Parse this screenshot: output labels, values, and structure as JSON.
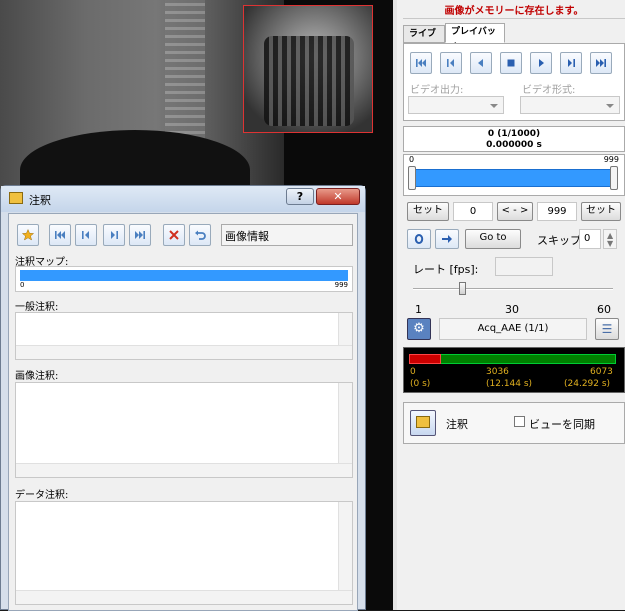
{
  "memory_status": "画像がメモリーに存在します。",
  "tabs": [
    {
      "label": "ライブ"
    },
    {
      "label": "プレイバック"
    }
  ],
  "playback": {
    "video_output_label": "ビデオ出力:",
    "video_format_label": "ビデオ形式:",
    "frame_display": "0 (1/1000)",
    "time_display": "0.000000 s",
    "slider_min": "0",
    "slider_max": "999",
    "set_left_label": "セット",
    "start_value": "0",
    "swap_label": "< - >",
    "end_value": "999",
    "set_right_label": "セット",
    "goto_label": "Go to",
    "skip_label": "スキップ:",
    "skip_value": "0",
    "rate_label": "レート [fps]:",
    "rate_value": "",
    "rate_ticks": [
      "1",
      "30",
      "60"
    ],
    "acq_label": "Acq_AAE (1/1)"
  },
  "timeline": {
    "start_frame": "0",
    "mid_frame": "3036",
    "end_frame": "6073",
    "start_time": "(0 s)",
    "mid_time": "(12.144 s)",
    "end_time": "(24.292 s)",
    "colors": {
      "buffer": "#cc0000",
      "recorded": "#008000",
      "text": "#e0b020"
    }
  },
  "annotation_panel": {
    "annotation_label": "注釈",
    "sync_view_label": "ビューを同期"
  },
  "dialog": {
    "title": "注釈",
    "image_info_field": "画像情報",
    "annotation_map_label": "注釈マップ:",
    "map_min": "0",
    "map_max": "999",
    "general_label": "一般注釈:",
    "image_label": "画像注釈:",
    "data_label": "データ注釈:",
    "help_label": "?",
    "close_label": "✕"
  },
  "icons": [
    "first-frame-icon",
    "previous-frame-icon",
    "play-backward-icon",
    "stop-icon",
    "play-forward-icon",
    "next-frame-icon",
    "last-frame-icon",
    "gear-icon",
    "list-icon",
    "star-icon",
    "delete-icon",
    "undo-icon",
    "annotation-note-icon"
  ]
}
